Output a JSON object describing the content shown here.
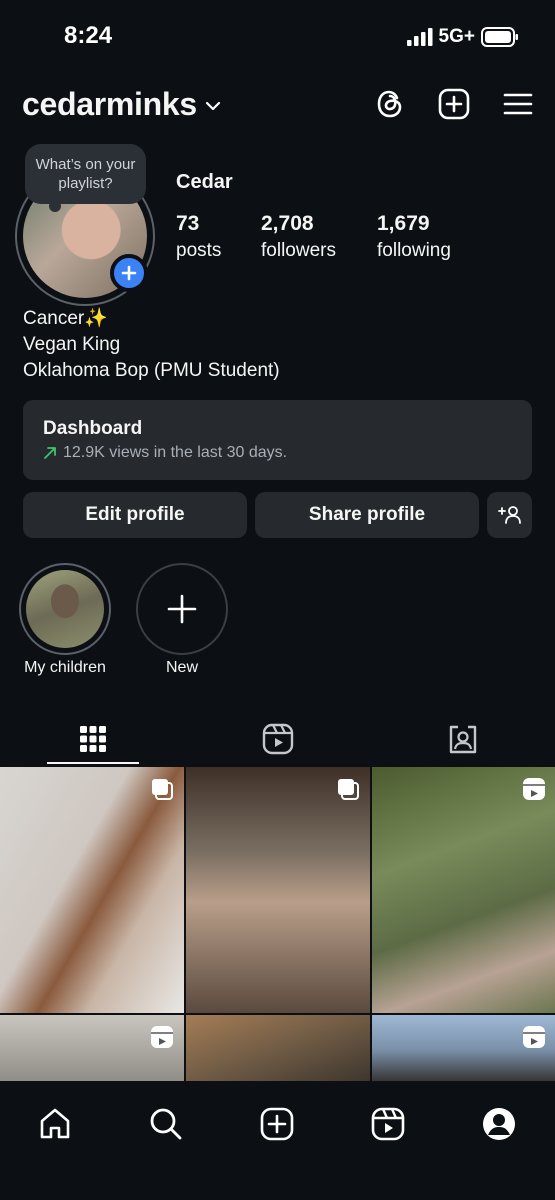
{
  "status_bar": {
    "time": "8:24",
    "network": "5G+"
  },
  "header": {
    "username": "cedarminks"
  },
  "profile": {
    "note": "What’s on your playlist?",
    "name": "Cedar",
    "stats": [
      {
        "value": "73",
        "label": "posts"
      },
      {
        "value": "2,708",
        "label": "followers"
      },
      {
        "value": "1,679",
        "label": "following"
      }
    ],
    "bio": [
      "Cancer✨",
      "Vegan King",
      "Oklahoma Bop (PMU Student)"
    ]
  },
  "dashboard": {
    "title": "Dashboard",
    "subtitle": "12.9K views in the last 30 days.",
    "trend_color": "#3ec46d"
  },
  "buttons": {
    "edit": "Edit profile",
    "share": "Share profile"
  },
  "highlights": [
    {
      "label": "My children"
    },
    {
      "label": "New"
    }
  ],
  "colors": {
    "accent": "#3b82f6",
    "background": "#0c1014",
    "surface": "#262a2f"
  }
}
